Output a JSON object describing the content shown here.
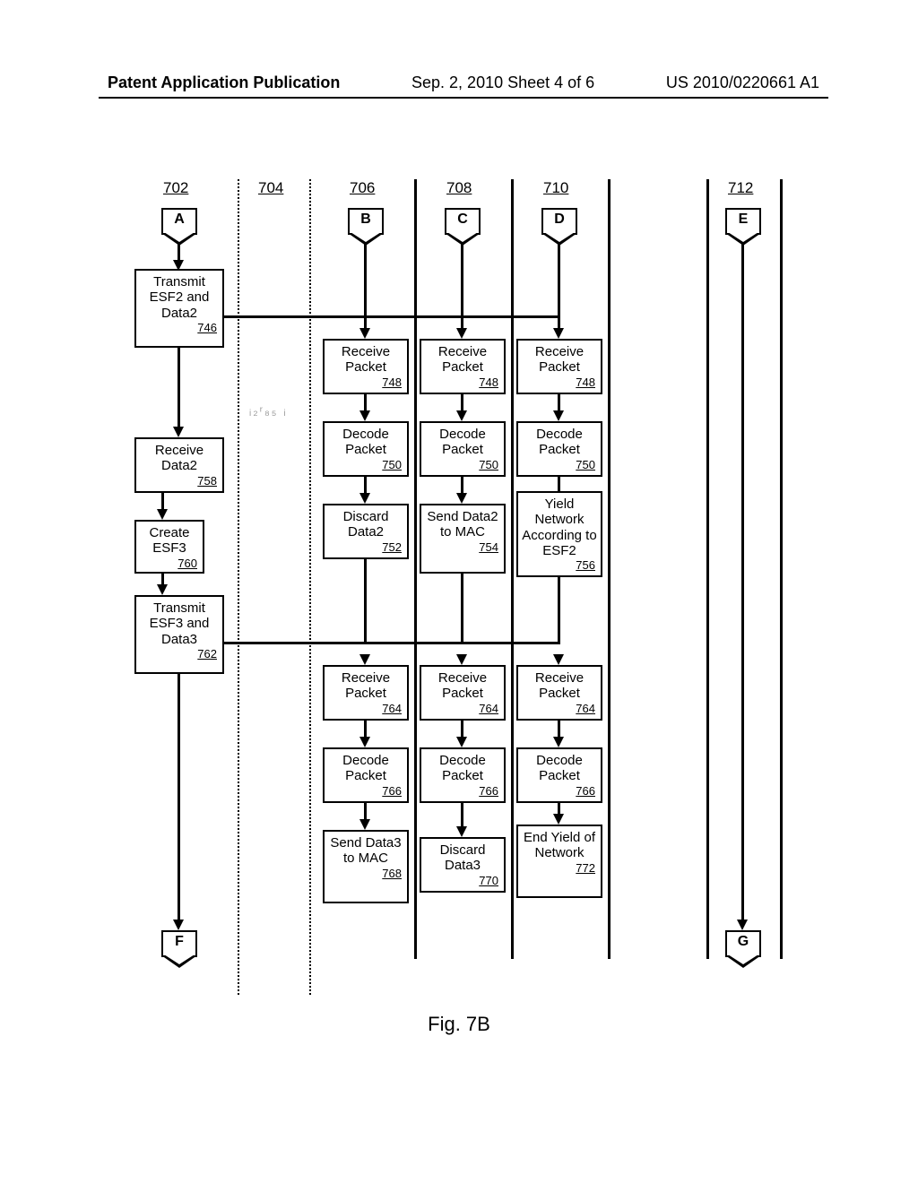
{
  "header": {
    "left": "Patent Application Publication",
    "mid": "Sep. 2, 2010  Sheet 4 of 6",
    "right": "US 2010/0220661 A1"
  },
  "lanes": {
    "l702": "702",
    "l704": "704",
    "l706": "706",
    "l708": "708",
    "l710": "710",
    "l712": "712"
  },
  "connectors": {
    "A": "A",
    "B": "B",
    "C": "C",
    "D": "D",
    "E": "E",
    "F": "F",
    "G": "G"
  },
  "steps": {
    "s746": "Transmit ESF2 and Data2",
    "r746": "746",
    "s748": "Receive Packet",
    "r748": "748",
    "s750": "Decode Packet",
    "r750": "750",
    "s752": "Discard Data2",
    "r752": "752",
    "s754": "Send Data2 to MAC",
    "r754": "754",
    "s756": "Yield Network According to ESF2",
    "r756": "756",
    "s758": "Receive Data2",
    "r758": "758",
    "s760": "Create ESF3",
    "r760": "760",
    "s762": "Transmit ESF3 and Data3",
    "r762": "762",
    "s764": "Receive Packet",
    "r764": "764",
    "s766": "Decode Packet",
    "r766": "766",
    "s768": "Send Data3 to MAC",
    "r768": "768",
    "s770": "Discard Data3",
    "r770": "770",
    "s772": "End Yield of Network",
    "r772": "772"
  },
  "artifact": "ᵢ₂ʳ₈₅ ᵢ",
  "figure_label": "Fig. 7B"
}
